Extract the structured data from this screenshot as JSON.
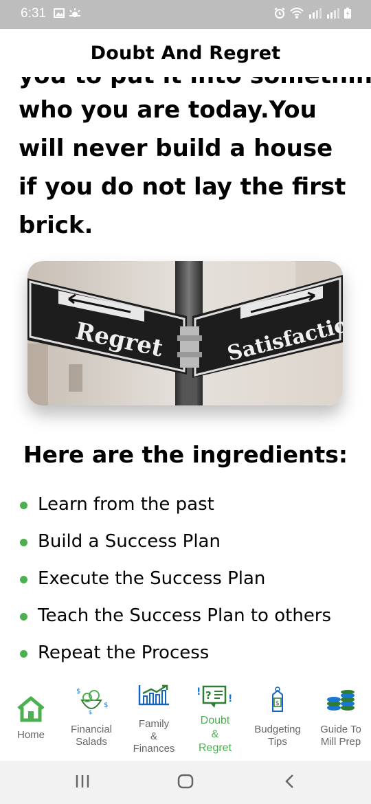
{
  "status_bar": {
    "time": "6:31",
    "icons": [
      "image-icon",
      "weather-icon",
      "alarm-icon",
      "wifi-icon",
      "signal-icon",
      "signal-icon",
      "battery-charging-icon"
    ]
  },
  "header": {
    "title": "Doubt And Regret"
  },
  "content": {
    "cut_line": "you to put it into something",
    "quote": "who you are today.You will never build a house if you do not lay the first brick.",
    "image": {
      "left_sign": "Regret",
      "right_sign": "Satisfaction"
    },
    "ingredients_title": "Here are the ingredients:",
    "ingredients": [
      "Learn from the past",
      "Build a Success Plan",
      "Execute the Success Plan",
      "Teach the Success Plan to others",
      "Repeat the Process"
    ]
  },
  "bottom_nav": {
    "items": [
      {
        "label_lines": [
          "Home"
        ],
        "icon": "home-icon"
      },
      {
        "label_lines": [
          "Financial",
          "Salads"
        ],
        "icon": "salad-money-icon"
      },
      {
        "label_lines": [
          "Family",
          "&",
          "Finances"
        ],
        "icon": "bar-chart-icon"
      },
      {
        "label_lines": [
          "Doubt",
          "&",
          "Regret"
        ],
        "icon": "question-list-icon",
        "active": true
      },
      {
        "label_lines": [
          "Budgeting",
          "Tips"
        ],
        "icon": "price-tag-icon"
      },
      {
        "label_lines": [
          "Guide To",
          "Mill Prep"
        ],
        "icon": "coins-stack-icon"
      }
    ]
  },
  "system_nav": {
    "buttons": [
      "recents-icon",
      "home-icon",
      "back-icon"
    ]
  },
  "colors": {
    "accent": "#4caf50",
    "status_bar": "#bdbdbd",
    "nav_label": "#666666"
  }
}
